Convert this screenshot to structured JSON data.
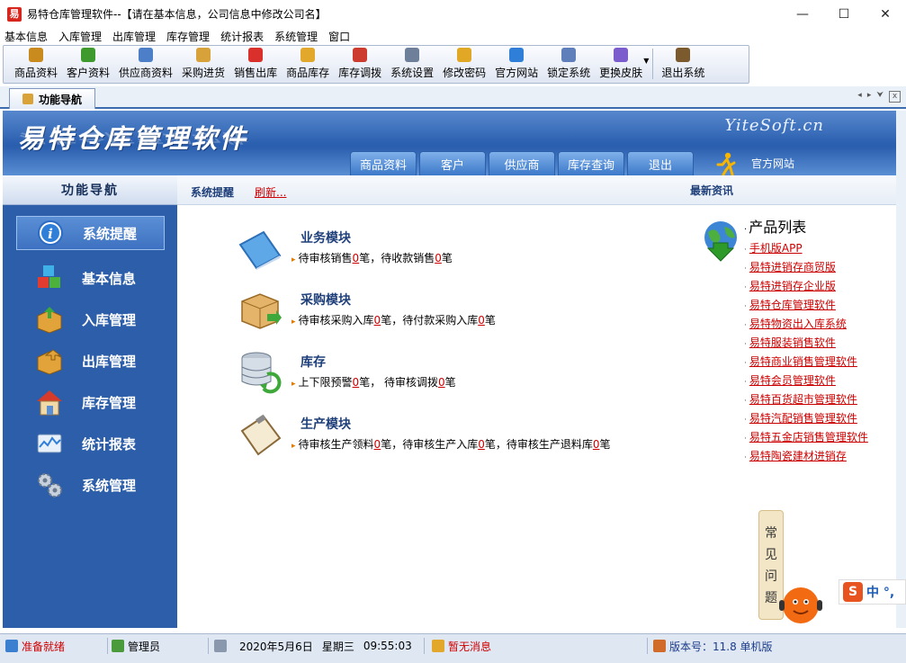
{
  "window": {
    "icon_text": "易",
    "title": "易特仓库管理软件--【请在基本信息，公司信息中修改公司名】",
    "controls": {
      "minimize": "—",
      "maximize": "☐",
      "close": "✕"
    }
  },
  "menu": [
    "基本信息",
    "入库管理",
    "出库管理",
    "库存管理",
    "统计报表",
    "系统管理",
    "窗口"
  ],
  "toolbar": [
    {
      "label": "商品资料",
      "icon": "goods-icon",
      "color": "#c98a1e"
    },
    {
      "label": "客户资料",
      "icon": "customers-icon",
      "color": "#3f9a2d"
    },
    {
      "label": "供应商资料",
      "icon": "suppliers-icon",
      "color": "#4d7fc8"
    },
    {
      "label": "采购进货",
      "icon": "purchase-icon",
      "color": "#d7a23a"
    },
    {
      "label": "销售出库",
      "icon": "sales-icon",
      "color": "#d9302b"
    },
    {
      "label": "商品库存",
      "icon": "stock-icon",
      "color": "#e1a82c"
    },
    {
      "label": "库存调拨",
      "icon": "transfer-icon",
      "color": "#cc3b2d"
    },
    {
      "label": "系统设置",
      "icon": "settings-icon",
      "color": "#6d7f99"
    },
    {
      "label": "修改密码",
      "icon": "key-icon",
      "color": "#e0a825"
    },
    {
      "label": "官方网站",
      "icon": "ie-icon",
      "color": "#2f7fd8"
    },
    {
      "label": "锁定系统",
      "icon": "lock-icon",
      "color": "#5e7fb9"
    },
    {
      "label": "更换皮肤",
      "icon": "skin-icon",
      "color": "#7a5ccc"
    },
    {
      "label": "退出系统",
      "icon": "exit-icon",
      "color": "#7b5a2d"
    }
  ],
  "tab": {
    "label": "功能导航",
    "controls": {
      "prev": "◂",
      "next": "▸",
      "menu": "⮟",
      "close": "x"
    }
  },
  "banner": {
    "brand": "易特仓库管理软件",
    "site": "YiteSoft.cn",
    "nav_tabs": [
      "商品资料",
      "客户",
      "供应商",
      "库存查询",
      "退出"
    ],
    "official": "官方网站"
  },
  "left_panel": {
    "title": "功能导航",
    "items": [
      {
        "label": "系统提醒",
        "icon": "info-icon",
        "selected": true
      },
      {
        "label": "基本信息",
        "icon": "cubes-icon"
      },
      {
        "label": "入库管理",
        "icon": "inbound-box-icon"
      },
      {
        "label": "出库管理",
        "icon": "outbound-box-icon"
      },
      {
        "label": "库存管理",
        "icon": "warehouse-house-icon"
      },
      {
        "label": "统计报表",
        "icon": "report-chart-icon"
      },
      {
        "label": "系统管理",
        "icon": "gears-icon"
      }
    ]
  },
  "main": {
    "header_label": "系统提醒",
    "refresh": "刷新...",
    "news": "最新资讯",
    "modules": [
      {
        "title": "业务模块",
        "icon": "book-icon",
        "parts": [
          {
            "t": "待审核销售"
          },
          {
            "n": "0"
          },
          {
            "t": "笔，待收款销售"
          },
          {
            "n": "0"
          },
          {
            "t": "笔"
          }
        ]
      },
      {
        "title": "采购模块",
        "icon": "purchase-box-icon",
        "parts": [
          {
            "t": "待审核采购入库"
          },
          {
            "n": "0"
          },
          {
            "t": "笔，待付款采购入库"
          },
          {
            "n": "0"
          },
          {
            "t": "笔"
          }
        ]
      },
      {
        "title": "库存",
        "icon": "database-icon",
        "parts": [
          {
            "t": "上下限预警"
          },
          {
            "n": "0"
          },
          {
            "t": "笔，   待审核调拨"
          },
          {
            "n": "0"
          },
          {
            "t": "笔"
          }
        ]
      },
      {
        "title": "生产模块",
        "icon": "clipboard-icon",
        "parts": [
          {
            "t": "待审核生产领料"
          },
          {
            "n": "0"
          },
          {
            "t": "笔，待审核生产入库"
          },
          {
            "n": "0"
          },
          {
            "t": "笔，待审核生产退料库"
          },
          {
            "n": "0"
          },
          {
            "t": "笔"
          }
        ]
      }
    ],
    "product_list": {
      "title": "产品列表",
      "items": [
        "手机版APP",
        "易特进销存商贸版",
        "易特进销存企业版",
        "易特仓库管理软件",
        "易特物资出入库系统",
        "易特服装销售软件",
        "易特商业销售管理软件",
        "易特会员管理软件",
        "易特百货超市管理软件",
        "易特汽配销售管理软件",
        "易特五金店销售管理软件",
        "易特陶瓷建材进销存"
      ]
    },
    "faq": [
      "常",
      "见",
      "问",
      "题"
    ]
  },
  "ime": {
    "logo": "S",
    "text": "中 °,"
  },
  "statusbar": {
    "ready": "准备就绪",
    "user": "管理员",
    "date": "2020年5月6日",
    "weekday": "星期三",
    "time": "09:55:03",
    "messages": "暂无消息",
    "version": "版本号：11.8 单机版"
  }
}
